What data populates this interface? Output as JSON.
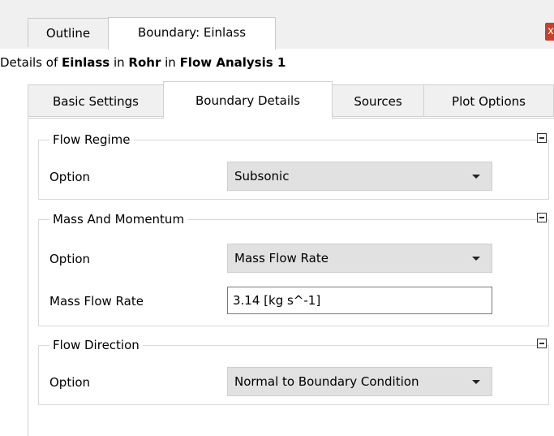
{
  "top_tabs": {
    "outline": "Outline",
    "boundary": "Boundary: Einlass",
    "close": "x"
  },
  "details": {
    "prefix": "Details of ",
    "object": "Einlass",
    "in1": " in ",
    "parent": "Rohr",
    "in2": " in ",
    "analysis": "Flow Analysis 1"
  },
  "tabs": [
    "Basic Settings",
    "Boundary Details",
    "Sources",
    "Plot Options"
  ],
  "active_tab": "Boundary Details",
  "groups": {
    "flow_regime": {
      "title": "Flow Regime",
      "option_label": "Option",
      "option_value": "Subsonic"
    },
    "mass_momentum": {
      "title": "Mass And Momentum",
      "option_label": "Option",
      "option_value": "Mass Flow Rate",
      "rate_label": "Mass Flow Rate",
      "rate_value": "3.14 [kg s^-1]"
    },
    "flow_direction": {
      "title": "Flow Direction",
      "option_label": "Option",
      "option_value": "Normal to Boundary Condition"
    }
  },
  "icons": {
    "close": "close-icon",
    "collapse": "collapse-icon",
    "dropdown": "chevron-down-icon"
  },
  "colors": {
    "close_button": "#c8402a",
    "background": "#ffffff",
    "tab_bg": "#f0f0f0"
  }
}
